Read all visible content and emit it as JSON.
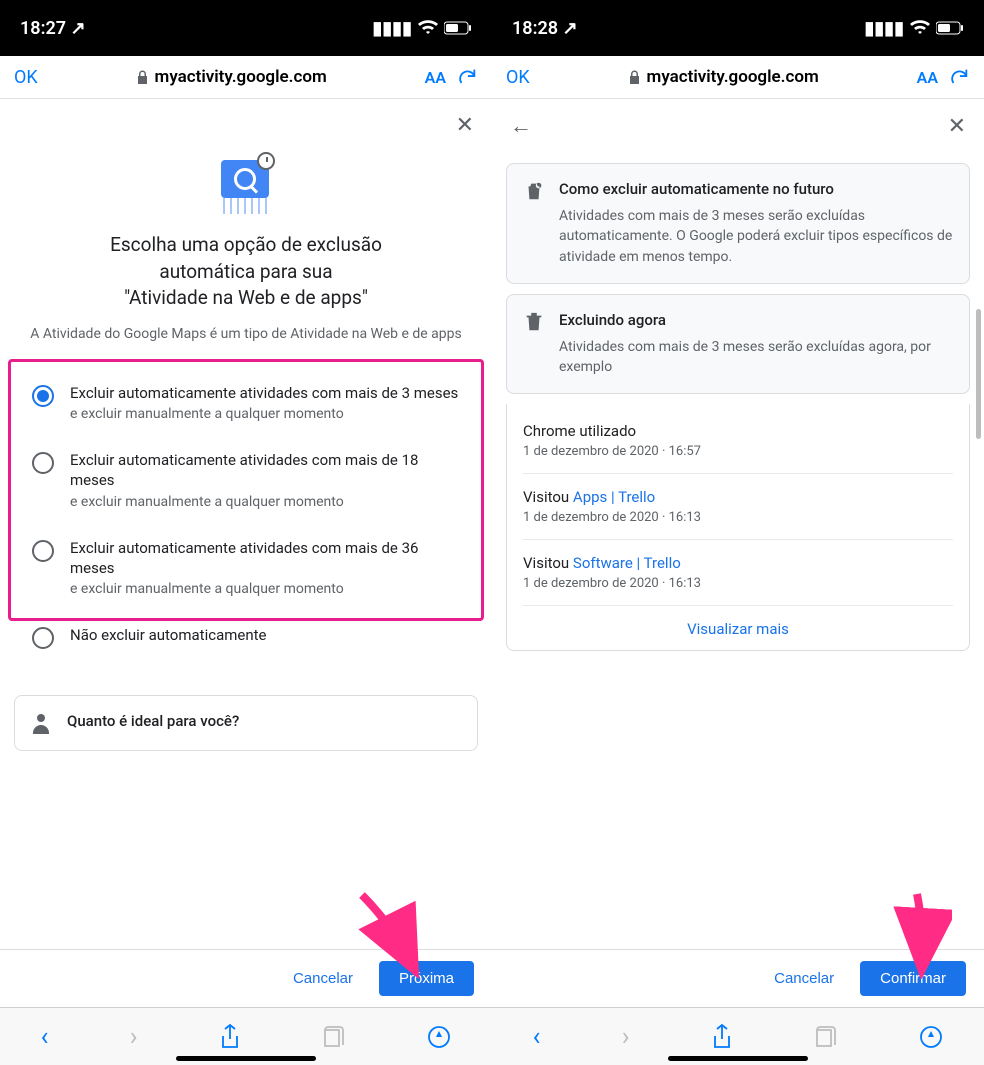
{
  "left": {
    "status": {
      "time": "18:27",
      "loc": "↗"
    },
    "browser": {
      "ok": "OK",
      "url": "myactivity.google.com"
    },
    "title_l1": "Escolha uma opção de exclusão",
    "title_l2": "automática para sua",
    "title_l3": "\"Atividade na Web e de apps\"",
    "subtitle": "A Atividade do Google Maps é um tipo de Atividade na Web e de apps",
    "options": [
      {
        "label": "Excluir automaticamente atividades com mais de 3 meses",
        "sub": "e excluir manualmente a qualquer momento",
        "selected": true
      },
      {
        "label": "Excluir automaticamente atividades com mais de 18 meses",
        "sub": "e excluir manualmente a qualquer momento",
        "selected": false
      },
      {
        "label": "Excluir automaticamente atividades com mais de 36 meses",
        "sub": "e excluir manualmente a qualquer momento",
        "selected": false
      },
      {
        "label": "Não excluir automaticamente",
        "sub": "",
        "selected": false
      }
    ],
    "info_title": "Quanto é ideal para você?",
    "cancel": "Cancelar",
    "next": "Próxima"
  },
  "right": {
    "status": {
      "time": "18:28",
      "loc": "↗"
    },
    "browser": {
      "ok": "OK",
      "url": "myactivity.google.com"
    },
    "card1": {
      "title": "Como excluir automaticamente no futuro",
      "desc": "Atividades com mais de 3 meses serão excluídas automaticamente. O Google poderá excluir tipos específicos de atividade em menos tempo."
    },
    "card2": {
      "title": "Excluindo agora",
      "desc": "Atividades com mais de 3 meses serão excluídas agora, por exemplo"
    },
    "items": [
      {
        "title": "Chrome utilizado",
        "link": "",
        "time": "1 de dezembro de 2020 · 16:57"
      },
      {
        "title": "Visitou ",
        "link": "Apps | Trello",
        "time": "1 de dezembro de 2020 · 16:13"
      },
      {
        "title": "Visitou ",
        "link": "Software | Trello",
        "time": "1 de dezembro de 2020 · 16:13"
      }
    ],
    "view_more": "Visualizar mais",
    "cancel": "Cancelar",
    "confirm": "Confirmar"
  }
}
